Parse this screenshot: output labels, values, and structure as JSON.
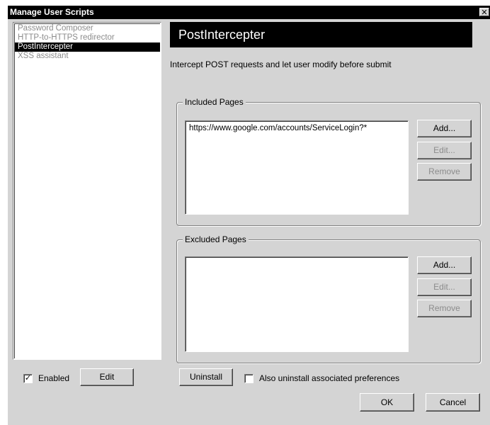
{
  "window": {
    "title": "Manage User Scripts",
    "close_glyph": "✕"
  },
  "scripts": {
    "items": [
      {
        "label": "Password Composer"
      },
      {
        "label": "HTTP-to-HTTPS redirector"
      },
      {
        "label": "PostIntercepter"
      },
      {
        "label": "XSS assistant"
      }
    ],
    "selected_index": 2
  },
  "left_controls": {
    "enabled_label": "Enabled",
    "enabled_checked": true,
    "check_glyph": "✓",
    "edit_label": "Edit"
  },
  "detail": {
    "name": "PostIntercepter",
    "description": "Intercept POST requests and let user modify before submit"
  },
  "included": {
    "label": "Included Pages",
    "urls": [
      "https://www.google.com/accounts/ServiceLogin?*"
    ],
    "add_label": "Add...",
    "edit_label": "Edit...",
    "remove_label": "Remove"
  },
  "excluded": {
    "label": "Excluded Pages",
    "urls": [],
    "add_label": "Add...",
    "edit_label": "Edit...",
    "remove_label": "Remove"
  },
  "bottom": {
    "uninstall_label": "Uninstall",
    "also_uninstall_label": "Also uninstall associated preferences",
    "also_uninstall_checked": false,
    "ok_label": "OK",
    "cancel_label": "Cancel"
  }
}
